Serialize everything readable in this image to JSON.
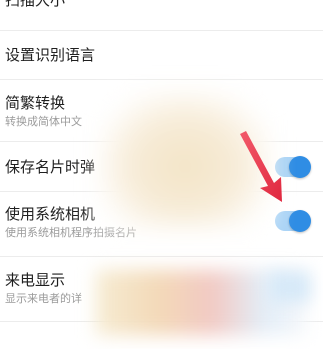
{
  "settings": {
    "items": [
      {
        "title": "扫描大小",
        "subtitle": ""
      },
      {
        "title": "设置识别语言",
        "subtitle": ""
      },
      {
        "title": "简繁转换",
        "subtitle": "转换成简体中文"
      },
      {
        "title": "保存名片时弹",
        "subtitle": "",
        "toggle": true
      },
      {
        "title": "使用系统相机",
        "subtitle": "使用系统相机程序拍摄名片",
        "toggle": true
      },
      {
        "title": "来电显示",
        "subtitle": "显示来电者的详"
      }
    ]
  },
  "colors": {
    "toggle_on": "#2f8de4",
    "annotation_arrow": "#e8364e"
  },
  "icons": {
    "annotation": "arrow-annotation"
  }
}
